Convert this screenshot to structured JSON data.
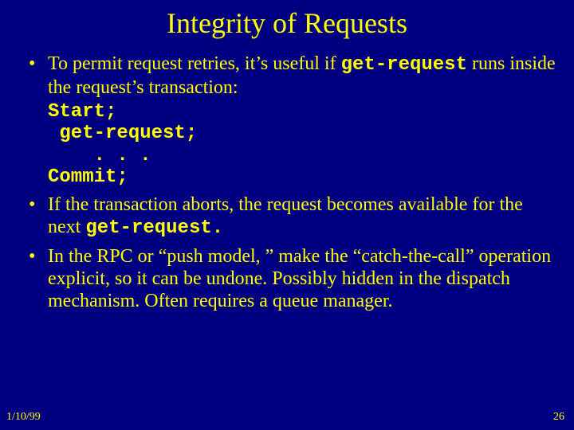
{
  "title": "Integrity of Requests",
  "bullets": {
    "b1a": "To permit request retries, it’s useful if ",
    "b1code": "get-request",
    "b1b": " runs inside the request’s transaction:",
    "code1": "Start;",
    "code2": " get-request;",
    "code3": "    . . .",
    "code4": "Commit;",
    "b2a": "If the transaction aborts, the request becomes available for the next ",
    "b2code": "get-request.",
    "b3": "In the RPC or “push model, ” make the “catch-the-call” operation explicit, so it can be undone. Possibly hidden in the dispatch mechanism. Often requires a queue manager."
  },
  "footer": {
    "date": "1/10/99",
    "page": "26"
  }
}
